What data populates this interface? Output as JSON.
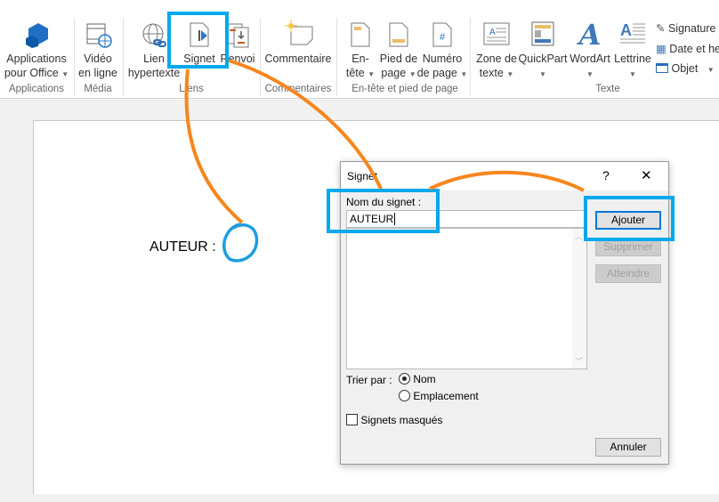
{
  "ribbon": {
    "groups": [
      {
        "label": "Applications",
        "items": [
          {
            "l1": "Applications",
            "l2": "pour Office",
            "caret": true
          }
        ]
      },
      {
        "label": "Média",
        "items": [
          {
            "l1": "Vidéo",
            "l2": "en ligne"
          }
        ]
      },
      {
        "label": "Liens",
        "items": [
          {
            "l1": "Lien",
            "l2": "hypertexte"
          },
          {
            "l1": "Signet"
          },
          {
            "l1": "Renvoi"
          }
        ]
      },
      {
        "label": "Commentaires",
        "items": [
          {
            "l1": "Commentaire"
          }
        ]
      },
      {
        "label": "En-tête et pied de page",
        "items": [
          {
            "l1": "En-",
            "l2": "tête"
          },
          {
            "l1": "Pied de",
            "l2": "page"
          },
          {
            "l1": "Numéro",
            "l2": "de page"
          }
        ]
      },
      {
        "label": "Texte",
        "items": [
          {
            "l1": "Zone de",
            "l2": "texte"
          },
          {
            "l1": "QuickPart"
          },
          {
            "l1": "WordArt"
          },
          {
            "l1": "Lettrine"
          }
        ]
      }
    ],
    "small_items": [
      "Signature",
      "Date et he",
      "Objet"
    ]
  },
  "document": {
    "text": "AUTEUR :"
  },
  "dialog": {
    "title": "Signet",
    "help": "?",
    "close": "✕",
    "name_label": "Nom du signet :",
    "name_value": "AUTEUR",
    "sort_label": "Trier par :",
    "sort_options": [
      "Nom",
      "Emplacement"
    ],
    "sort_selected": "Nom",
    "hidden_label": "Signets masqués",
    "buttons": {
      "add": "Ajouter",
      "delete": "Supprimer",
      "goto": "Atteindre",
      "cancel": "Annuler"
    }
  },
  "colors": {
    "highlight": "#00a8ec",
    "annotation": "#f7861e",
    "accent": "#2b6cb8"
  }
}
